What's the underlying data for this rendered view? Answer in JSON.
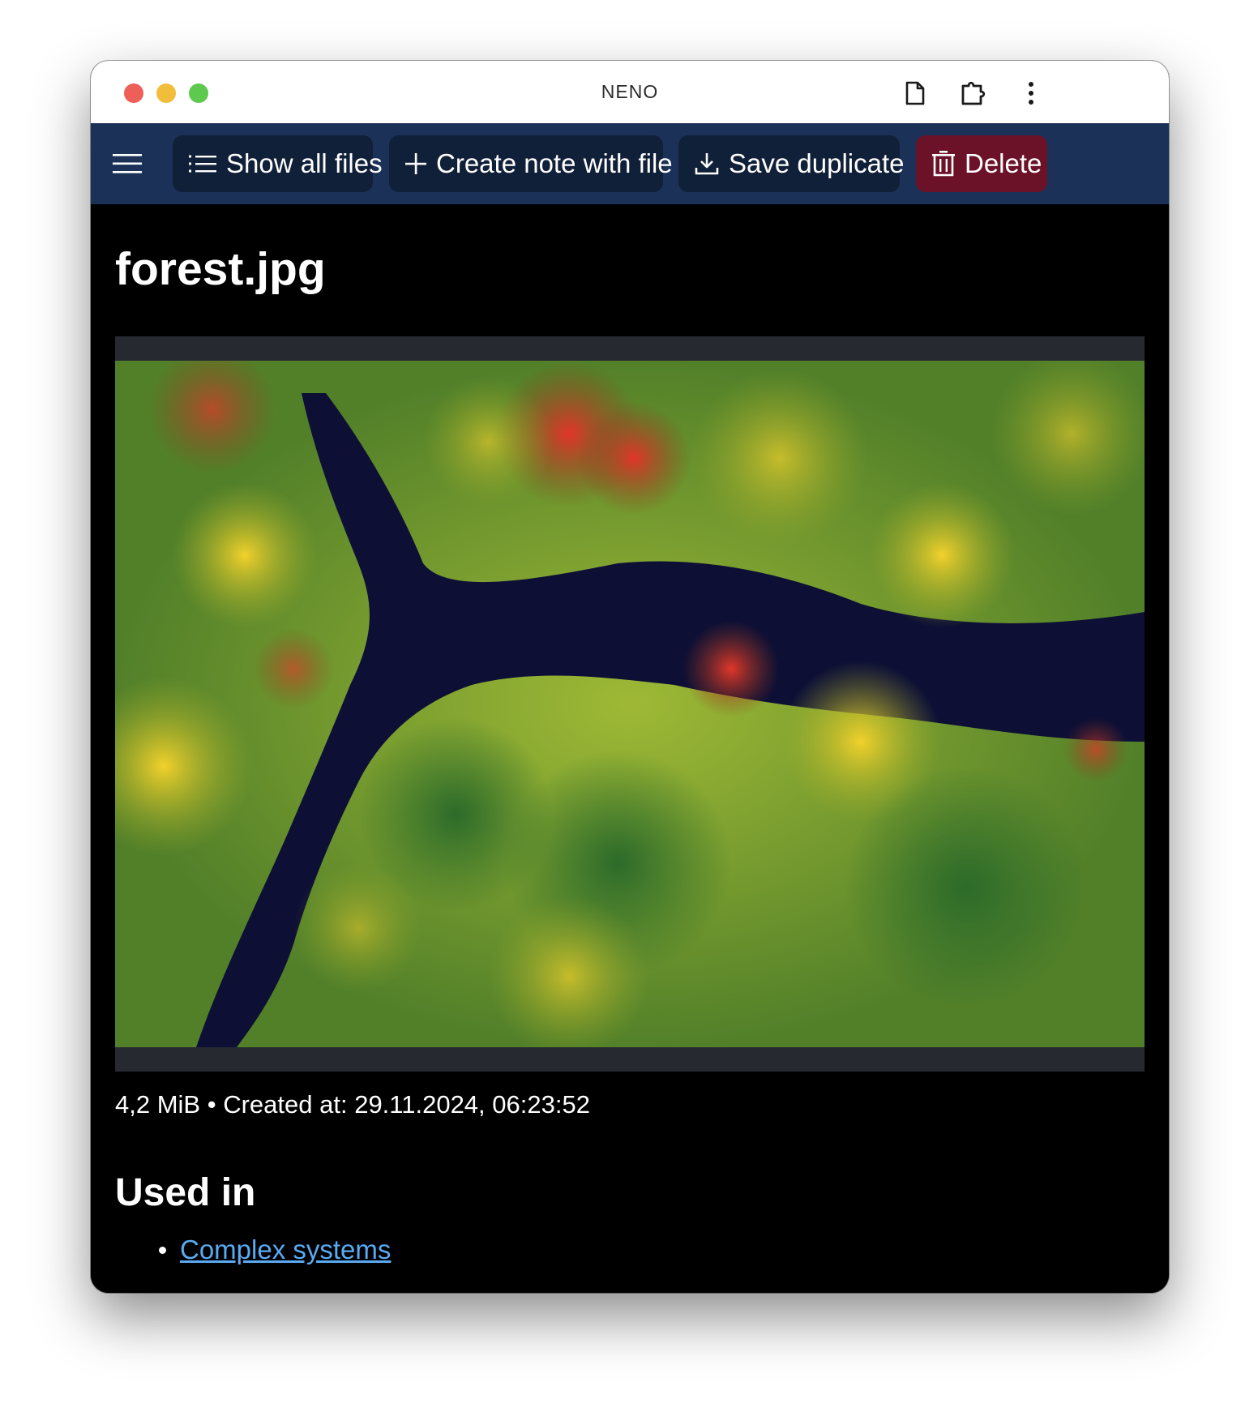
{
  "window": {
    "title": "NENO",
    "traffic_colors": {
      "close": "#ed5f57",
      "minimize": "#f1bd3a",
      "zoom": "#5ec94f"
    },
    "titlebar_icons": [
      "new-file-icon",
      "extension-puzzle-icon",
      "more-vertical-icon"
    ]
  },
  "toolbar": {
    "background": "#1b3157",
    "menu_icon": "hamburger-menu-icon",
    "buttons": {
      "show_all_files": {
        "label": "Show all files",
        "icon": "list-icon"
      },
      "create_note": {
        "label": "Create note with file",
        "icon": "plus-icon"
      },
      "save_duplicate": {
        "label": "Save duplicate",
        "icon": "download-icon"
      },
      "delete": {
        "label": "Delete",
        "icon": "trash-icon",
        "color": "#6b1228"
      }
    }
  },
  "file": {
    "name": "forest.jpg",
    "size": "4,2 MiB",
    "created_label": "Created at: 29.11.2024, 06:23:52",
    "separator": "•"
  },
  "used_in": {
    "heading": "Used in",
    "items": [
      {
        "label": "Complex systems",
        "color": "#5aaaf2"
      }
    ]
  }
}
